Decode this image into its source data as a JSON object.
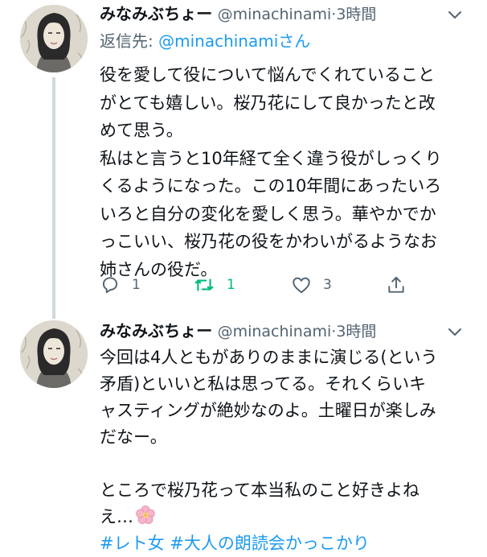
{
  "colors": {
    "link": "#1d9bf0",
    "secondary_text": "#536471",
    "retweet_active": "#00ba7c",
    "thread_line": "#cfd9de"
  },
  "tweets": [
    {
      "display_name": "みなみぶちょー",
      "handle": "@minachinami",
      "separator": "·",
      "time": "3時間",
      "reply_prefix": "返信先: ",
      "reply_mention": "@minachinami",
      "reply_suffix": "さん",
      "body_lines": [
        "役を愛して役について悩んでくれていること",
        "がとても嬉しい。桜乃花にして良かったと改",
        "めて思う。",
        "私はと言うと10年経て全く違う役がしっくり",
        "くるようになった。この10年間にあったいろ",
        "いろと自分の変化を愛しく思う。華やかでか",
        "っこいい、桜乃花の役をかわいがるようなお",
        "姉さんの役だ。"
      ],
      "counts": {
        "replies": "1",
        "retweets": "1",
        "likes": "3"
      },
      "icons": {
        "reply": "reply-icon",
        "retweet": "retweet-icon",
        "like": "heart-icon",
        "share": "share-icon",
        "more": "chevron-down-icon"
      }
    },
    {
      "display_name": "みなみぶちょー",
      "handle": "@minachinami",
      "separator": "·",
      "time": "3時間",
      "body_lines": [
        "今回は4人ともがありのままに演じる(という",
        "矛盾)といいと私は思ってる。それくらいキ",
        "ャスティングが絶妙なのよ。土曜日が楽しみ",
        "だなー。",
        "",
        "ところで桜乃花って本当私のこと好きよね",
        "え…"
      ],
      "emoji": "cherry-blossom-icon",
      "hashtags": [
        "#レト女",
        "#大人の朗読会かっこかり"
      ],
      "icons": {
        "more": "chevron-down-icon"
      }
    }
  ]
}
